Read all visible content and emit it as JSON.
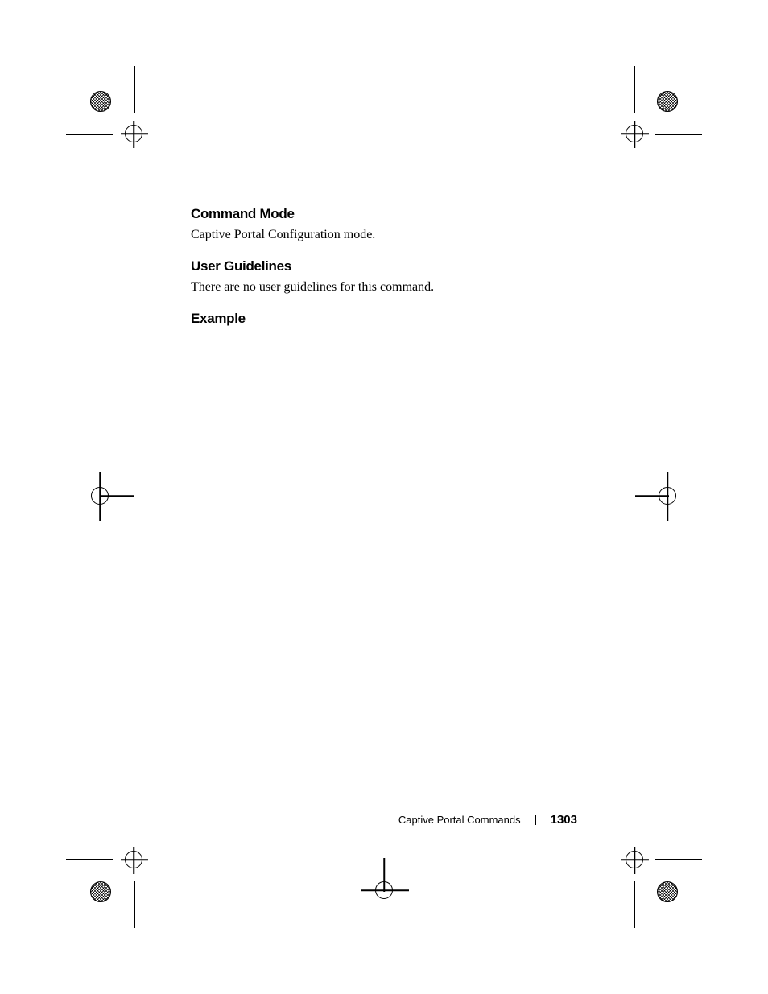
{
  "sections": {
    "commandMode": {
      "heading": "Command Mode",
      "body": "Captive Portal Configuration mode."
    },
    "userGuidelines": {
      "heading": "User Guidelines",
      "body": "There are no user guidelines for this command."
    },
    "example": {
      "heading": "Example"
    }
  },
  "footer": {
    "section": "Captive Portal Commands",
    "pageNumber": "1303"
  }
}
